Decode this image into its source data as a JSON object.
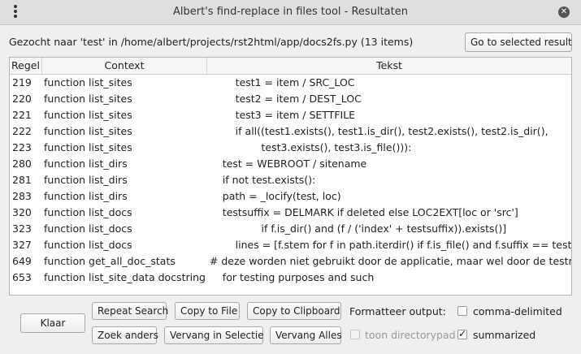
{
  "window": {
    "title": "Albert's find-replace in files tool - Resultaten",
    "menu_icon": "kebab-menu-icon",
    "close_icon": "close-icon"
  },
  "header": {
    "info": "Gezocht naar 'test' in /home/albert/projects/rst2html/app/docs2fs.py (13 items)",
    "go_button": "Go to selected result"
  },
  "table": {
    "columns": [
      "Regel",
      "Context",
      "Tekst"
    ],
    "rows": [
      {
        "regel": "219",
        "context": "function list_sites",
        "tekst": "            test1 = item / SRC_LOC"
      },
      {
        "regel": "220",
        "context": "function list_sites",
        "tekst": "            test2 = item / DEST_LOC"
      },
      {
        "regel": "221",
        "context": "function list_sites",
        "tekst": "            test3 = item / SETTFILE"
      },
      {
        "regel": "222",
        "context": "function list_sites",
        "tekst": "            if all((test1.exists(), test1.is_dir(), test2.exists(), test2.is_dir(),"
      },
      {
        "regel": "223",
        "context": "function list_sites",
        "tekst": "                    test3.exists(), test3.is_file())):"
      },
      {
        "regel": "280",
        "context": "function list_dirs",
        "tekst": "        test = WEBROOT / sitename"
      },
      {
        "regel": "281",
        "context": "function list_dirs",
        "tekst": "        if not test.exists():"
      },
      {
        "regel": "283",
        "context": "function list_dirs",
        "tekst": "        path = _locify(test, loc)"
      },
      {
        "regel": "320",
        "context": "function list_docs",
        "tekst": "        testsuffix = DELMARK if deleted else LOC2EXT[loc or 'src']"
      },
      {
        "regel": "323",
        "context": "function list_docs",
        "tekst": "                    if f.is_dir() and (f / ('index' + testsuffix)).exists()]"
      },
      {
        "regel": "327",
        "context": "function list_docs",
        "tekst": "            lines = [f.stem for f in path.iterdir() if f.is_file() and f.suffix == testsuffix]"
      },
      {
        "regel": "649",
        "context": "function get_all_doc_stats",
        "tekst": "    # deze worden niet gebruikt door de applicatie, maar wel door de testroutines"
      },
      {
        "regel": "653",
        "context": "function list_site_data docstring",
        "tekst": "        for testing purposes and such"
      }
    ]
  },
  "buttons": {
    "klaar": "Klaar",
    "repeat_search": "Repeat Search",
    "copy_to_file": "Copy to File",
    "copy_to_clipboard": "Copy to Clipboard",
    "zoek_anders": "Zoek anders",
    "vervang_in_selectie": "Vervang in Selectie",
    "vervang_alles": "Vervang Alles"
  },
  "options": {
    "label": "Formatteer output:",
    "comma_delimited": {
      "label": "comma-delimited",
      "checked": false,
      "enabled": true
    },
    "toon_directorypad": {
      "label": "toon directorypad",
      "checked": false,
      "enabled": false
    },
    "summarized": {
      "label": "summarized",
      "checked": true,
      "enabled": true
    }
  }
}
